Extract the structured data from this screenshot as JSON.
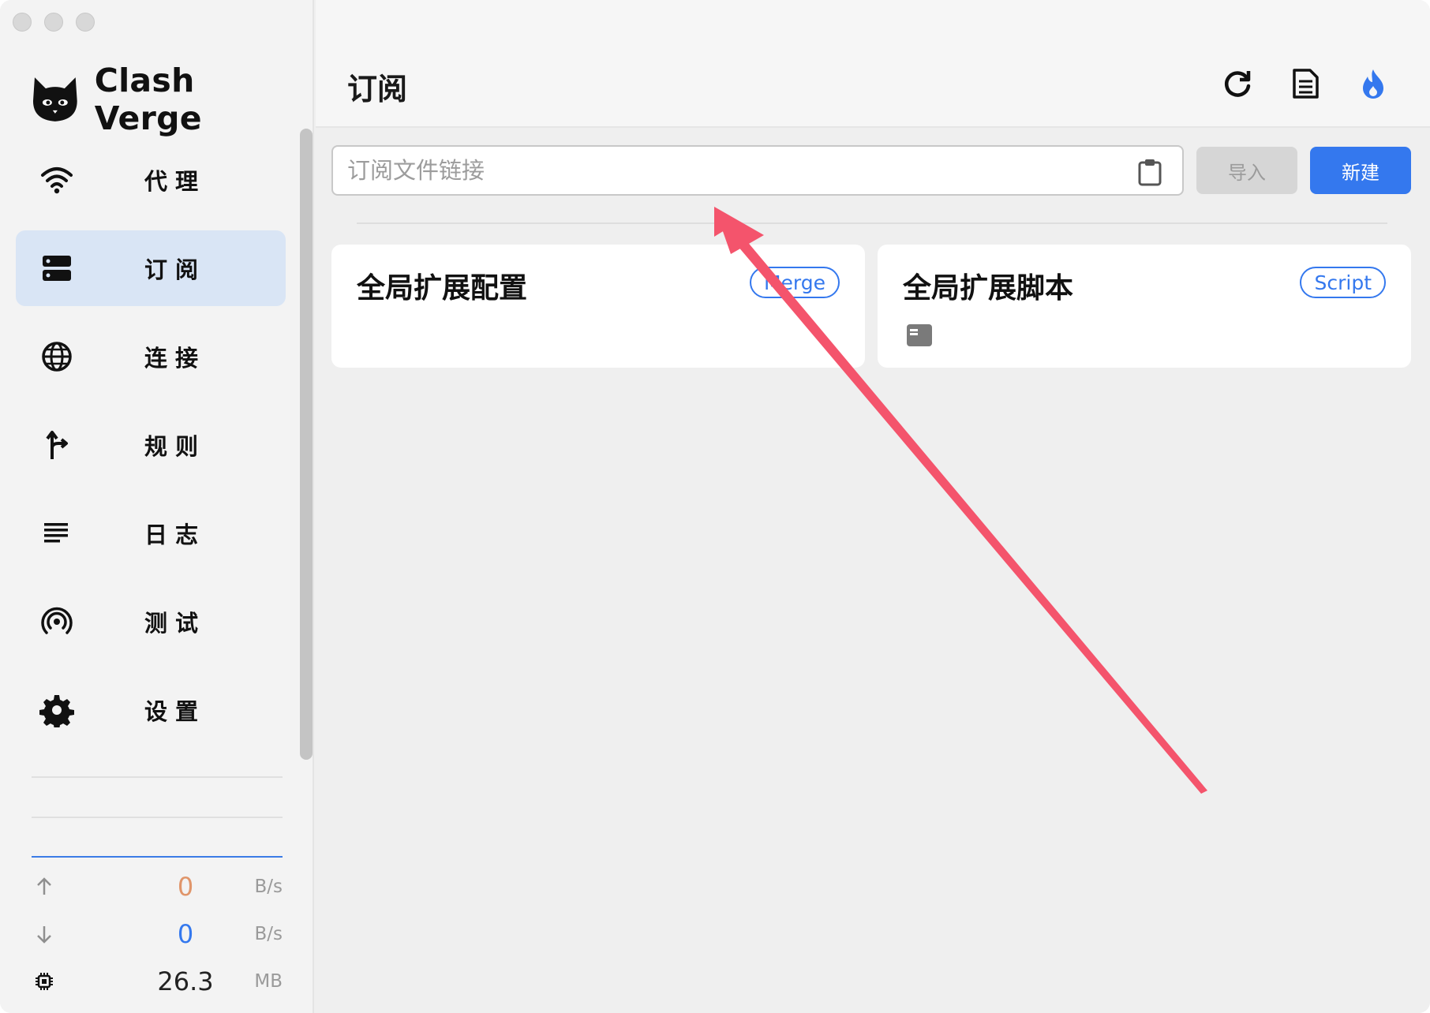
{
  "app": {
    "name": "Clash Verge"
  },
  "sidebar": {
    "items": [
      {
        "label": "代理",
        "icon": "wifi-icon"
      },
      {
        "label": "订阅",
        "icon": "server-icon",
        "active": true
      },
      {
        "label": "连接",
        "icon": "globe-icon"
      },
      {
        "label": "规则",
        "icon": "route-icon"
      },
      {
        "label": "日志",
        "icon": "list-icon"
      },
      {
        "label": "测试",
        "icon": "radar-icon"
      },
      {
        "label": "设置",
        "icon": "gear-icon"
      }
    ],
    "stats": {
      "upload": {
        "value": "0",
        "unit": "B/s",
        "color": "#e0956a"
      },
      "download": {
        "value": "0",
        "unit": "B/s",
        "color": "#3478ee"
      },
      "memory": {
        "value": "26.3",
        "unit": "MB",
        "color": "#222222"
      }
    }
  },
  "header": {
    "title": "订阅",
    "actions": [
      "refresh-icon",
      "document-icon",
      "flame-icon"
    ]
  },
  "subscription": {
    "url_placeholder": "订阅文件链接",
    "url_value": "",
    "import_label": "导入",
    "new_label": "新建"
  },
  "cards": [
    {
      "title": "全局扩展配置",
      "tag": "Merge"
    },
    {
      "title": "全局扩展脚本",
      "tag": "Script"
    }
  ],
  "colors": {
    "accent": "#3478ee",
    "active_nav_bg": "#d9e5f5",
    "annotation_arrow": "#f4546c"
  }
}
